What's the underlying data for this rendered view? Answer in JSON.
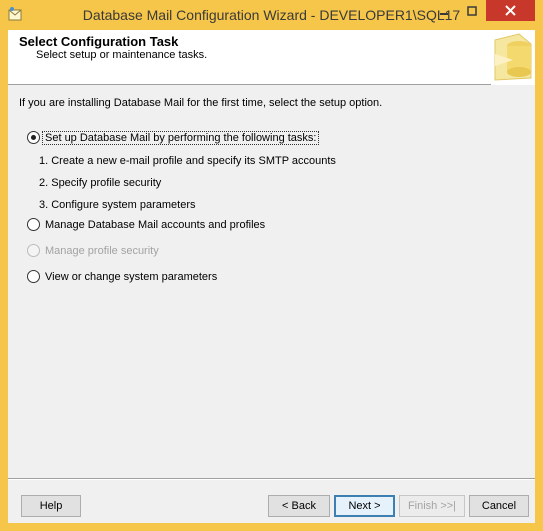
{
  "window": {
    "title": "Database Mail Configuration Wizard - DEVELOPER1\\SQL17"
  },
  "header": {
    "title": "Select Configuration Task",
    "subtitle": "Select setup or maintenance tasks."
  },
  "intro": "If you are installing Database Mail for the first time, select the setup option.",
  "options": [
    {
      "label": "Set up Database Mail by performing the following tasks:",
      "selected": true,
      "enabled": true
    },
    {
      "label": "Manage Database Mail accounts and profiles",
      "selected": false,
      "enabled": true
    },
    {
      "label": "Manage profile security",
      "selected": false,
      "enabled": false
    },
    {
      "label": "View or change system parameters",
      "selected": false,
      "enabled": true
    }
  ],
  "steps": [
    "1. Create a new e-mail profile and specify its SMTP accounts",
    "2. Specify profile security",
    "3. Configure system parameters"
  ],
  "buttons": {
    "help": "Help",
    "back": "< Back",
    "next": "Next >",
    "finish": "Finish >>|",
    "cancel": "Cancel"
  },
  "colors": {
    "frame": "#f5c64a",
    "close": "#c7372a",
    "client": "#f0f0f0"
  }
}
